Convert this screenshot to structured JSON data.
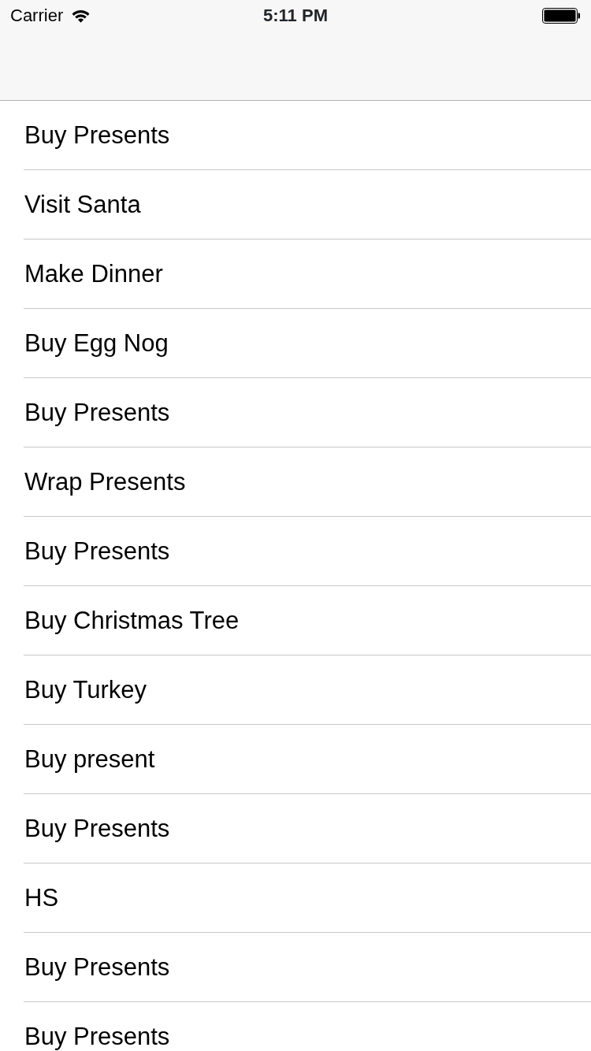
{
  "status_bar": {
    "carrier": "Carrier",
    "time": "5:11 PM"
  },
  "tasks": [
    {
      "title": "Buy Presents"
    },
    {
      "title": "Visit Santa"
    },
    {
      "title": "Make Dinner"
    },
    {
      "title": "Buy Egg Nog"
    },
    {
      "title": "Buy Presents"
    },
    {
      "title": "Wrap Presents"
    },
    {
      "title": "Buy Presents"
    },
    {
      "title": "Buy Christmas Tree"
    },
    {
      "title": "Buy Turkey"
    },
    {
      "title": "Buy present"
    },
    {
      "title": "Buy Presents"
    },
    {
      "title": "HS"
    },
    {
      "title": "Buy Presents"
    },
    {
      "title": "Buy Presents"
    }
  ]
}
